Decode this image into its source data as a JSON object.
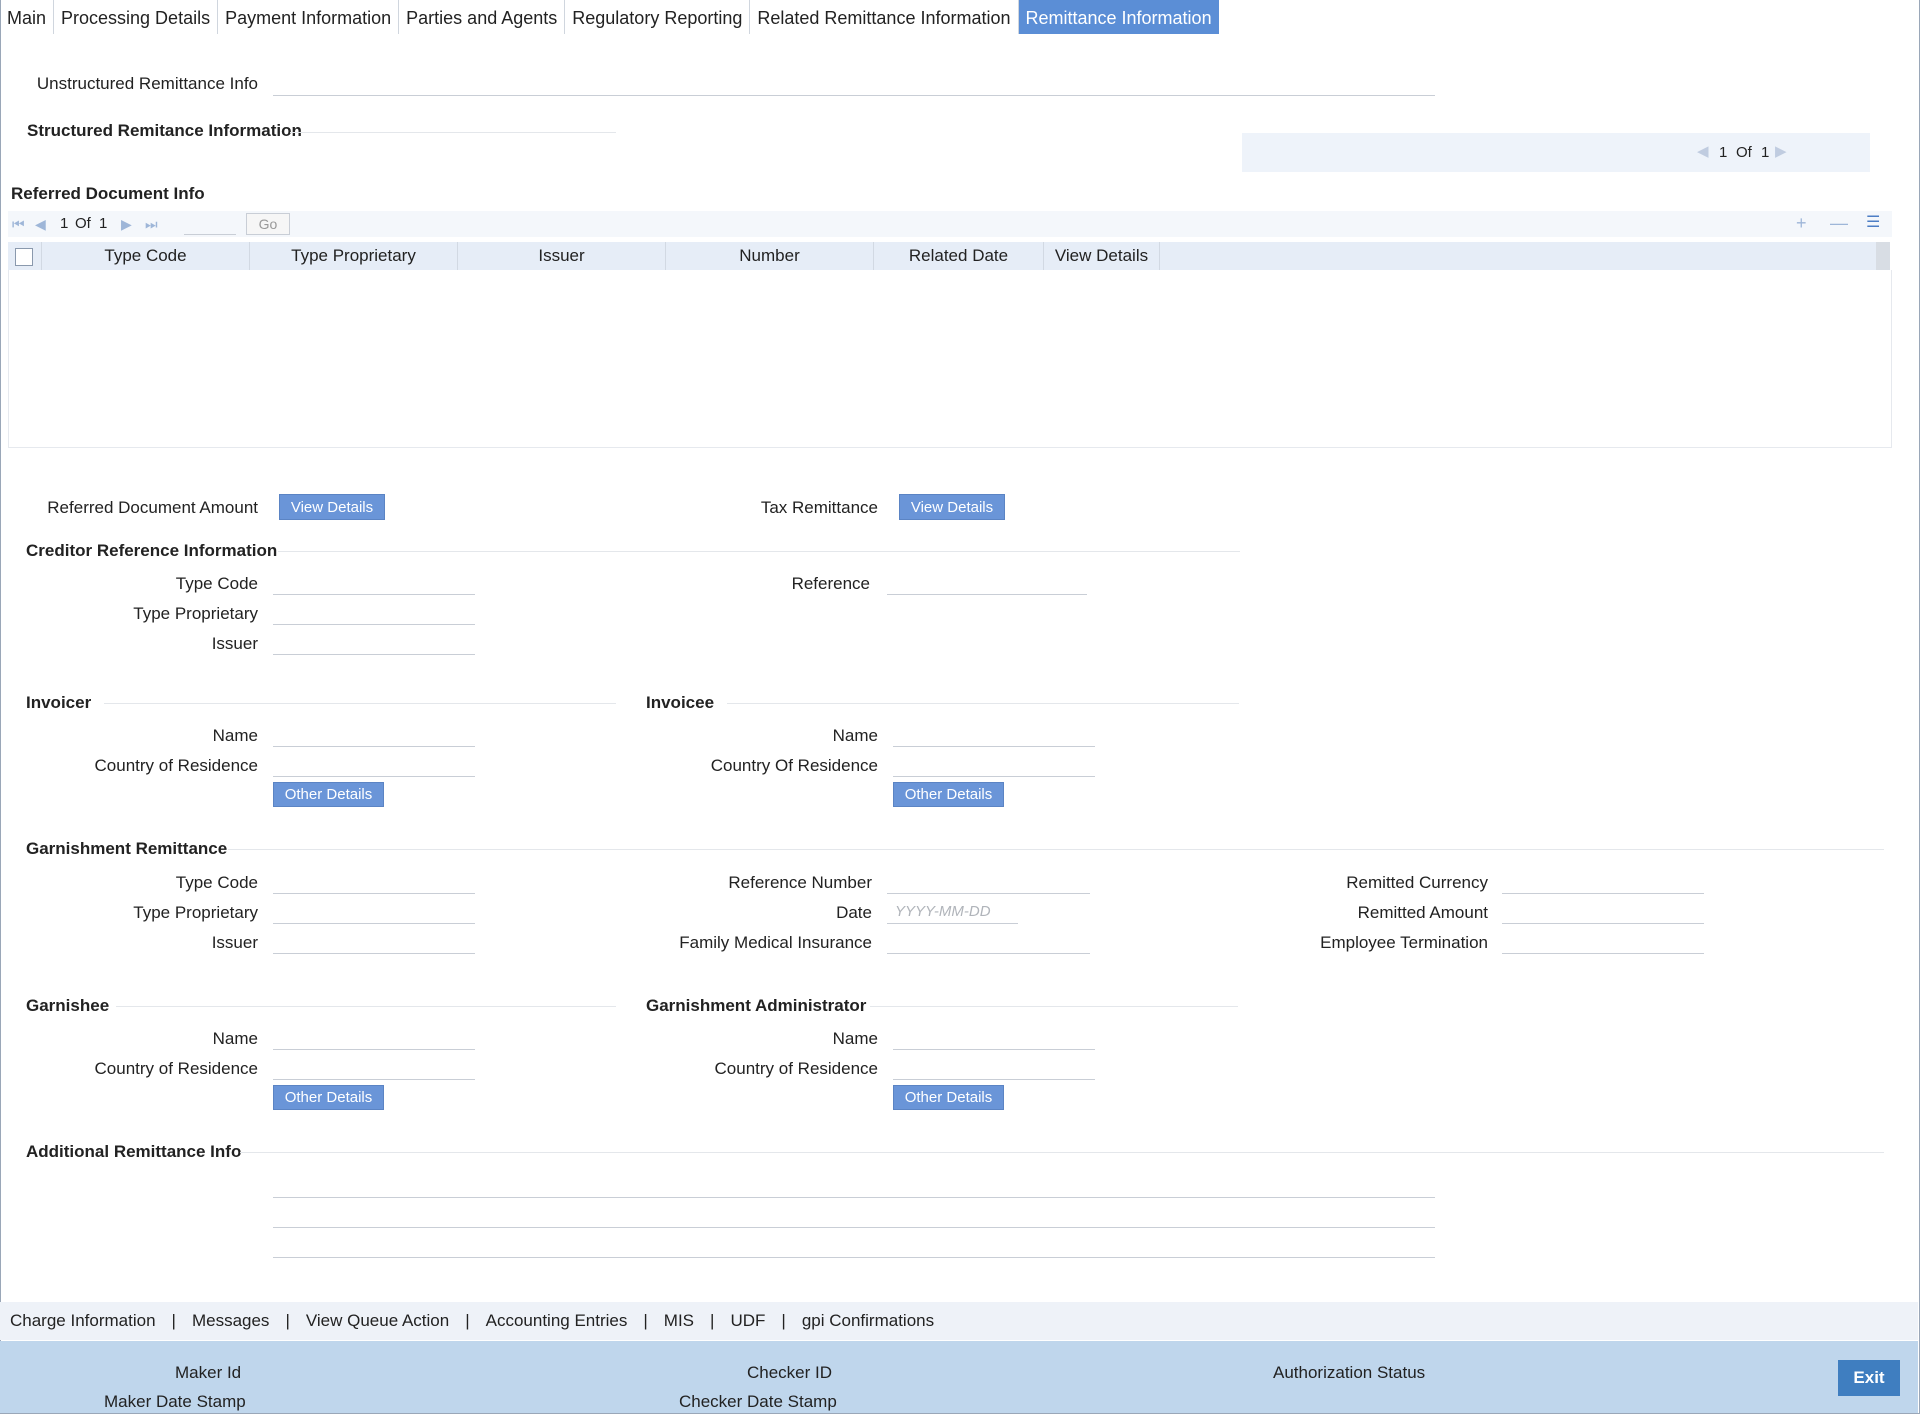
{
  "tabs": [
    {
      "label": "Main"
    },
    {
      "label": "Processing Details"
    },
    {
      "label": "Payment Information"
    },
    {
      "label": "Parties and Agents"
    },
    {
      "label": "Regulatory Reporting"
    },
    {
      "label": "Related Remittance Information"
    },
    {
      "label": "Remittance Information",
      "active": true
    }
  ],
  "unstructured": {
    "label": "Unstructured Remittance Info",
    "value": ""
  },
  "structured": {
    "title": "Structured Remitance Information",
    "pager_current": "1",
    "pager_of": "Of",
    "pager_total": "1"
  },
  "referred_doc": {
    "title": "Referred Document Info",
    "pager_current": "1",
    "pager_of": "Of",
    "pager_total": "1",
    "go_label": "Go",
    "columns": [
      "Type Code",
      "Type Proprietary",
      "Issuer",
      "Number",
      "Related Date",
      "View Details"
    ]
  },
  "referred_amount": {
    "label": "Referred Document Amount",
    "button": "View Details"
  },
  "tax_remittance": {
    "label": "Tax Remittance",
    "button": "View Details"
  },
  "creditor": {
    "title": "Creditor Reference Information",
    "type_code": "Type Code",
    "type_proprietary": "Type Proprietary",
    "issuer": "Issuer",
    "reference": "Reference"
  },
  "invoicer": {
    "title": "Invoicer",
    "name": "Name",
    "country": "Country of Residence",
    "button": "Other Details"
  },
  "invoicee": {
    "title": "Invoicee",
    "name": "Name",
    "country": "Country Of Residence",
    "button": "Other Details"
  },
  "garnishment": {
    "title": "Garnishment Remittance",
    "type_code": "Type Code",
    "type_proprietary": "Type Proprietary",
    "issuer": "Issuer",
    "reference_number": "Reference Number",
    "date": "Date",
    "date_placeholder": "YYYY-MM-DD",
    "family_medical": "Family Medical Insurance",
    "remitted_currency": "Remitted Currency",
    "remitted_amount": "Remitted Amount",
    "employee_termination": "Employee Termination"
  },
  "garnishee": {
    "title": "Garnishee",
    "name": "Name",
    "country": "Country of Residence",
    "button": "Other Details"
  },
  "garnish_admin": {
    "title": "Garnishment Administrator",
    "name": "Name",
    "country": "Country of Residence",
    "button": "Other Details"
  },
  "additional": {
    "title": "Additional Remittance Info"
  },
  "footer_links": [
    "Charge Information",
    "Messages",
    "View Queue Action",
    "Accounting Entries",
    "MIS",
    "UDF",
    "gpi Confirmations"
  ],
  "audit": {
    "maker_id": "Maker Id",
    "maker_date": "Maker Date Stamp",
    "checker_id": "Checker ID",
    "checker_date": "Checker Date Stamp",
    "auth_status": "Authorization Status"
  },
  "exit_label": "Exit"
}
